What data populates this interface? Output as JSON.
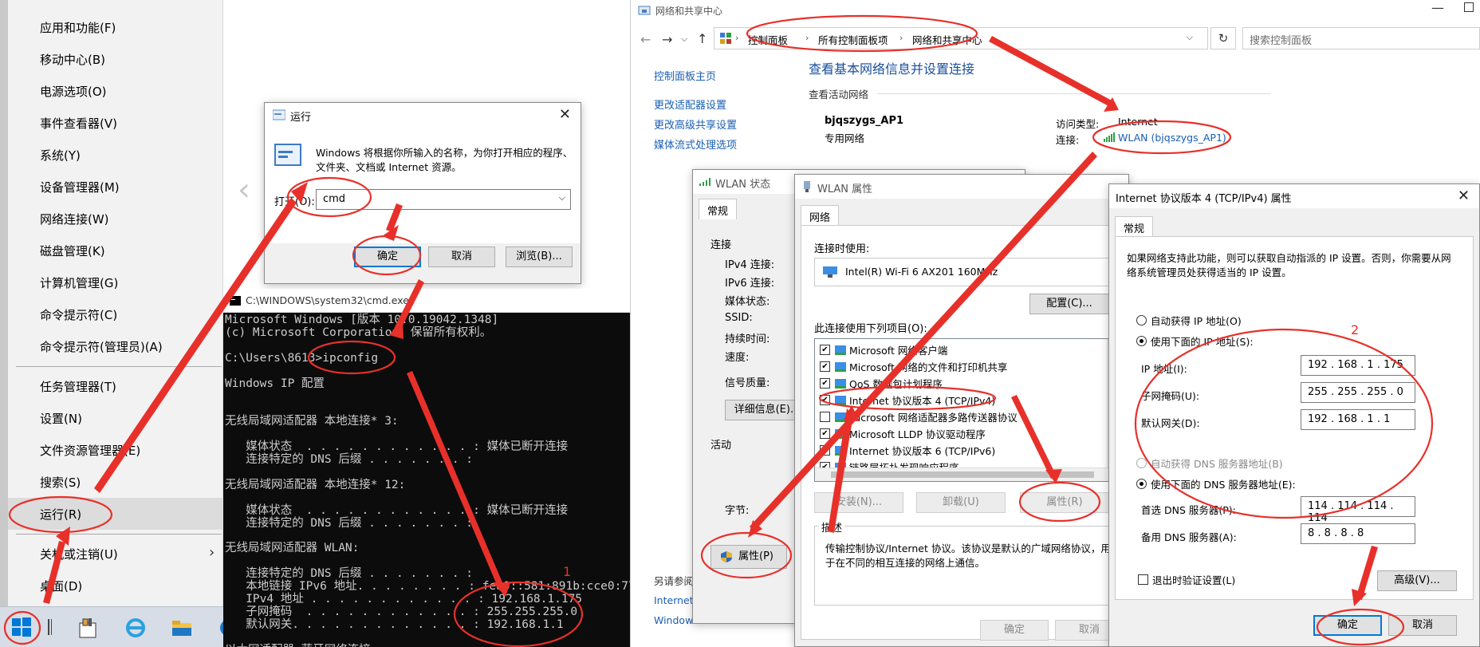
{
  "start_menu": {
    "items": [
      "应用和功能(F)",
      "移动中心(B)",
      "电源选项(O)",
      "事件查看器(V)",
      "系统(Y)",
      "设备管理器(M)",
      "网络连接(W)",
      "磁盘管理(K)",
      "计算机管理(G)",
      "命令提示符(C)",
      "命令提示符(管理员)(A)",
      "任务管理器(T)",
      "设置(N)",
      "文件资源管理器(E)",
      "搜索(S)",
      "运行(R)",
      "关机或注销(U)",
      "桌面(D)"
    ]
  },
  "run_dialog": {
    "title": "运行",
    "desc_line1": "Windows 将根据你所输入的名称，为你打开相应的程序、",
    "desc_line2": "文件夹、文档或 Internet 资源。",
    "open_label": "打开(O):",
    "open_value": "cmd",
    "ok": "确定",
    "cancel": "取消",
    "browse": "浏览(B)..."
  },
  "cmd": {
    "title": "C:\\WINDOWS\\system32\\cmd.exe",
    "lines": [
      "Microsoft Windows [版本 10.0.19042.1348]",
      "(c) Microsoft Corporation。保留所有权利。",
      "",
      "C:\\Users\\8613>ipconfig",
      "",
      "Windows IP 配置",
      "",
      "",
      "无线局域网适配器 本地连接* 3:",
      "",
      "   媒体状态  . . . . . . . . . . . . : 媒体已断开连接",
      "   连接特定的 DNS 后缀 . . . . . . . :",
      "",
      "无线局域网适配器 本地连接* 12:",
      "",
      "   媒体状态  . . . . . . . . . . . . : 媒体已断开连接",
      "   连接特定的 DNS 后缀 . . . . . . . :",
      "",
      "无线局域网适配器 WLAN:",
      "",
      "   连接特定的 DNS 后缀 . . . . . . . :",
      "   本地链接 IPv6 地址. . . . . . . . : fe80::581:891b:cce0:77aa%",
      "   IPv4 地址 . . . . . . . . . . . . : 192.168.1.175",
      "   子网掩码  . . . . . . . . . . . . : 255.255.255.0",
      "   默认网关. . . . . . . . . . . . . : 192.168.1.1",
      "",
      "以太网适配器 蓝牙网络连接:"
    ]
  },
  "network": {
    "title": "网络和共享中心",
    "breadcrumb": [
      "控制面板",
      "所有控制面板项",
      "网络和共享中心"
    ],
    "search_placeholder": "搜索控制面板",
    "sidebar": [
      "控制面板主页",
      "更改适配器设置",
      "更改高级共享设置",
      "媒体流式处理选项"
    ],
    "heading": "查看基本网络信息并设置连接",
    "active_label": "查看活动网络",
    "net_name": "bjqszygs_AP1",
    "net_type": "专用网络",
    "access_label": "访问类型:",
    "access_value": "Internet",
    "conn_label": "连接:",
    "conn_value": "WLAN (bjqszygs_AP1)",
    "see_also": "另请参阅",
    "bottom_link1": "Internet",
    "bottom_link2": "Window"
  },
  "wlan_status": {
    "title": "WLAN 状态",
    "tab": "常规",
    "section_conn": "连接",
    "rows": [
      "IPv4 连接:",
      "IPv6 连接:",
      "媒体状态:",
      "SSID:",
      "持续时间:",
      "速度:"
    ],
    "signal": "信号质量:",
    "details_btn": "详细信息(E)...",
    "section_activity": "活动",
    "bytes_label": "字节:",
    "props_btn": "属性(P)"
  },
  "wlan_props": {
    "title": "WLAN 属性",
    "tab": "网络",
    "connect_using": "连接时使用:",
    "adapter": "Intel(R) Wi-Fi 6 AX201 160MHz",
    "config_btn": "配置(C)...",
    "items_label": "此连接使用下列项目(O):",
    "items": [
      {
        "label": "Microsoft 网络客户端",
        "checked": true
      },
      {
        "label": "Microsoft 网络的文件和打印机共享",
        "checked": true
      },
      {
        "label": "QoS 数据包计划程序",
        "checked": true
      },
      {
        "label": "Internet 协议版本 4 (TCP/IPv4)",
        "checked": true
      },
      {
        "label": "Microsoft 网络适配器多路传送器协议",
        "checked": false
      },
      {
        "label": "Microsoft LLDP 协议驱动程序",
        "checked": true
      },
      {
        "label": "Internet 协议版本 6 (TCP/IPv6)",
        "checked": true
      },
      {
        "label": "链路层拓扑发现响应程序",
        "checked": true
      }
    ],
    "install_btn": "安装(N)...",
    "uninstall_btn": "卸载(U)",
    "props_btn": "属性(R)",
    "desc_title": "描述",
    "desc_line1": "传输控制协议/Internet 协议。该协议是默认的广域网络协议，用",
    "desc_line2": "于在不同的相互连接的网络上通信。",
    "ok": "确定",
    "cancel": "取消"
  },
  "ipv4": {
    "title": "Internet 协议版本 4 (TCP/IPv4) 属性",
    "tab": "常规",
    "desc_line1": "如果网络支持此功能，则可以获取自动指派的 IP 设置。否则，你需要从网",
    "desc_line2": "络系统管理员处获得适当的 IP 设置。",
    "auto_ip": "自动获得 IP 地址(O)",
    "manual_ip": "使用下面的 IP 地址(S):",
    "ip_label": "IP 地址(I):",
    "ip_value": "192 . 168 .  1  . 175",
    "mask_label": "子网掩码(U):",
    "mask_value": "255 . 255 . 255 .  0",
    "gw_label": "默认网关(D):",
    "gw_value": "192 . 168 .  1  .  1",
    "auto_dns": "自动获得 DNS 服务器地址(B)",
    "manual_dns": "使用下面的 DNS 服务器地址(E):",
    "dns1_label": "首选 DNS 服务器(P):",
    "dns1_value": "114 . 114 . 114 . 114",
    "dns2_label": "备用 DNS 服务器(A):",
    "dns2_value": " 8  .  8  .  8  .  8",
    "validate": "退出时验证设置(L)",
    "advanced": "高级(V)...",
    "ok": "确定",
    "cancel": "取消"
  },
  "annotations": {
    "step1": "1",
    "step2": "2",
    "color": "#e8302a"
  }
}
